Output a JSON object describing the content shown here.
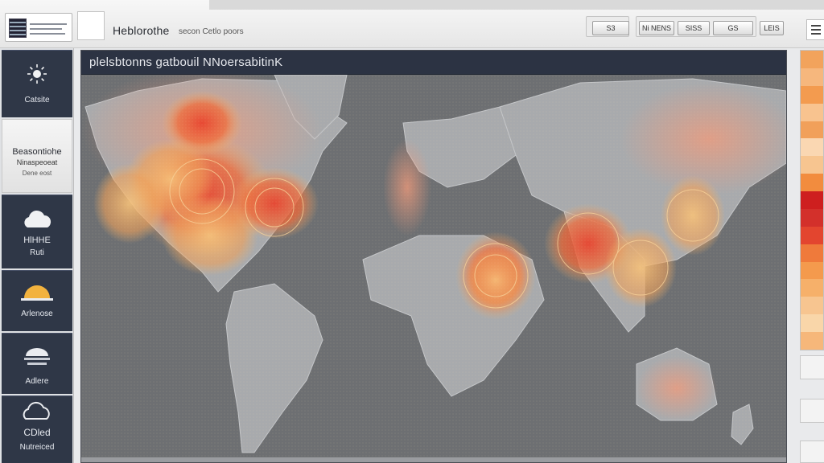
{
  "header": {
    "brand": "Heblorothe",
    "brand_sub": "secon Cetlo poors",
    "buttons": [
      "S3",
      "Ni NENS",
      "SISS",
      "GS"
    ],
    "extra_button": "LEIS"
  },
  "sidebar": {
    "items": [
      {
        "label": "Catsite",
        "icon": "sun-icon"
      },
      {
        "label_1": "Beasontiohe",
        "label_2": "Ninaspeoeat",
        "label_3": "Dene eost"
      },
      {
        "label_1": "HlHHE",
        "label_2": "Ruti",
        "icon": "cloud-icon"
      },
      {
        "label": "Arlenose",
        "icon": "sunset-icon"
      },
      {
        "label": "Adlere",
        "icon": "storm-icon"
      },
      {
        "label_1": "CDled",
        "label_2": "Nutreiced",
        "icon": "wind-cloud-icon"
      }
    ]
  },
  "main": {
    "title": "plelsbtonns gatbouil NNoersabitinK"
  },
  "legend": {
    "colors": [
      "#f2a35c",
      "#f6b77d",
      "#f39b4f",
      "#f8c38f",
      "#f1a05a",
      "#fad7b2",
      "#f7c590",
      "#f28c3e",
      "#ce1f1f",
      "#d3302b",
      "#e3452f",
      "#ef7a3b",
      "#f49a4d",
      "#f6b06a",
      "#f7c590",
      "#f9d6a9",
      "#f6b77a"
    ]
  },
  "colors": {
    "header_bg": "#2c3343",
    "map_bg": "#6d6f72",
    "land": "#a8aaad",
    "hot": "#e8442f",
    "warm": "#f2b36a"
  }
}
